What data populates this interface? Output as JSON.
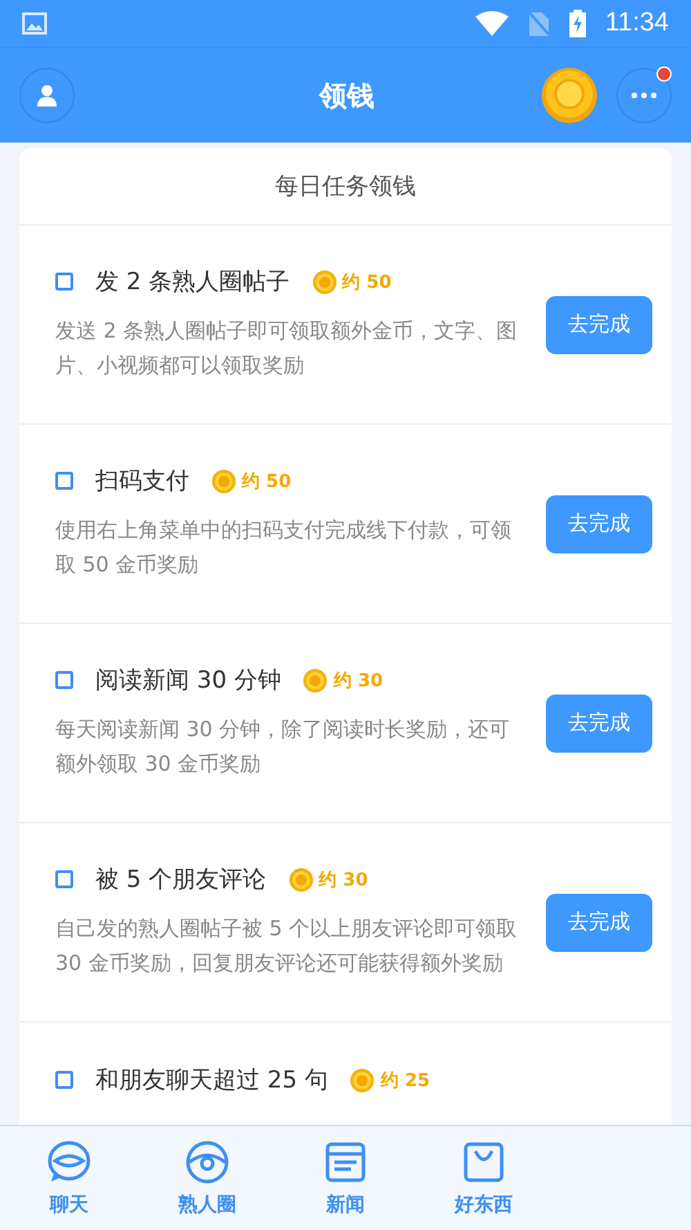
{
  "status_bar": {
    "time": "11:34"
  },
  "header": {
    "title": "领钱",
    "notification_dot": true
  },
  "card": {
    "title": "每日任务领钱"
  },
  "tasks": [
    {
      "title": "发 2 条熟人圈帖子",
      "reward": "约 50",
      "checked": false,
      "description": "发送 2 条熟人圈帖子即可领取额外金币，文字、图片、小视频都可以领取奖励",
      "button": "去完成"
    },
    {
      "title": "扫码支付",
      "reward": "约 50",
      "checked": false,
      "description": "使用右上角菜单中的扫码支付完成线下付款，可领取 50 金币奖励",
      "button": "去完成"
    },
    {
      "title": "阅读新闻 30 分钟",
      "reward": "约 30",
      "checked": false,
      "description": "每天阅读新闻 30 分钟，除了阅读时长奖励，还可额外领取 30 金币奖励",
      "button": "去完成"
    },
    {
      "title": "被 5 个朋友评论",
      "reward": "约 30",
      "checked": false,
      "description": "自己发的熟人圈帖子被 5 个以上朋友评论即可领取 30 金币奖励，回复朋友评论还可能获得额外奖励",
      "button": "去完成"
    },
    {
      "title": "和朋友聊天超过 25 句",
      "reward": "约 25",
      "checked": false
    }
  ],
  "bottom_nav": [
    {
      "label": "聊天",
      "kind": "chat"
    },
    {
      "label": "熟人圈",
      "kind": "circle"
    },
    {
      "label": "新闻",
      "kind": "news"
    },
    {
      "label": "好东西",
      "kind": "bag"
    }
  ]
}
